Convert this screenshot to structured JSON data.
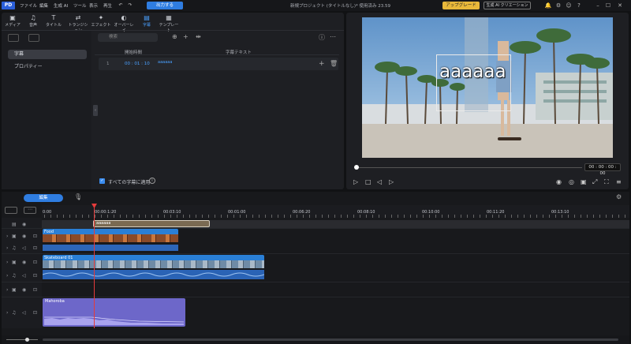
{
  "titlebar": {
    "logo": "PD",
    "menus": [
      "ファイル",
      "編集",
      "生成 AI",
      "ツール",
      "表示",
      "再生"
    ],
    "export_label": "出力する",
    "doc_title": "新規プロジェクト (タイトルなし)* 使用済み 23.59",
    "upgrade_label": "アップグレード",
    "ai_create_label": "生成 AI クリエーション"
  },
  "tools": [
    {
      "icon": "▣",
      "label": "メディア"
    },
    {
      "icon": "♫",
      "label": "音声"
    },
    {
      "icon": "T",
      "label": "タイトル"
    },
    {
      "icon": "⇄",
      "label": "トランジション"
    },
    {
      "icon": "✦",
      "label": "エフェクト"
    },
    {
      "icon": "◐",
      "label": "オーバーレイ"
    },
    {
      "icon": "▤",
      "label": "字幕"
    },
    {
      "icon": "▦",
      "label": "テンプレート"
    }
  ],
  "subnav": {
    "items": [
      "字幕",
      "プロパティー"
    ]
  },
  "subtitle_panel": {
    "search_placeholder": "検索",
    "col_start": "開始時間",
    "col_text": "字幕テキスト",
    "rows": [
      {
        "index": "1",
        "start": "00 : 01 : 10",
        "text": "aaaaaa"
      }
    ],
    "apply_all_label": "すべての字幕に適用"
  },
  "preview": {
    "overlay_text": "aaaaaa",
    "timecode": "00 : 00 : 00 : 00"
  },
  "timeline": {
    "tab_label": "編集",
    "ruler_labels": [
      "0:00",
      "00:00:1:20",
      "00:03:10",
      "00:01:00",
      "00:06:20",
      "00:08:10",
      "00:10:00",
      "00:11:20",
      "00:13:10"
    ],
    "subtitle_clip": "aaaaaa",
    "clips": [
      {
        "name": "Food"
      },
      {
        "name": "Skateboard 01"
      },
      {
        "name": "Mahoroba"
      }
    ]
  },
  "colors": {
    "accent": "#2f7de1",
    "upgrade": "#e8b83a",
    "playhead": "#e53b3b",
    "music_clip": "#6d67c9",
    "subtitle_clip": "#7a6a52"
  }
}
